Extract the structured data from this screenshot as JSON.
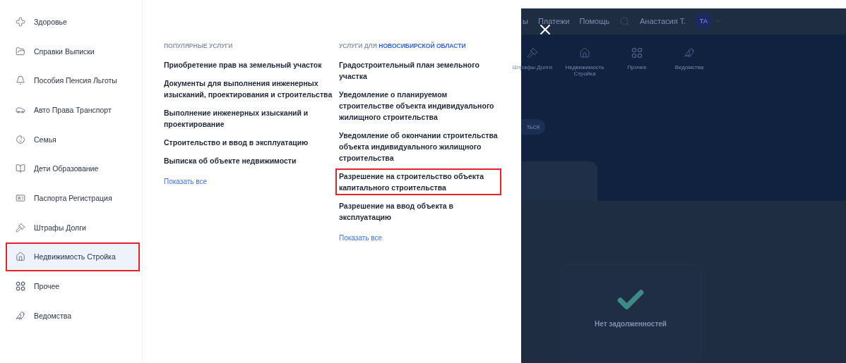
{
  "sidebar": {
    "items": [
      {
        "label": "Здоровье",
        "selected": false,
        "highlighted": false
      },
      {
        "label": "Справки Выписки",
        "selected": false,
        "highlighted": false
      },
      {
        "label": "Пособия Пенсия Льготы",
        "selected": false,
        "highlighted": false
      },
      {
        "label": "Авто Права Транспорт",
        "selected": false,
        "highlighted": false
      },
      {
        "label": "Семья",
        "selected": false,
        "highlighted": false
      },
      {
        "label": "Дети Образование",
        "selected": false,
        "highlighted": false
      },
      {
        "label": "Паспорта Регистрация",
        "selected": false,
        "highlighted": false
      },
      {
        "label": "Штрафы Долги",
        "selected": false,
        "highlighted": false
      },
      {
        "label": "Недвижимость Стройка",
        "selected": true,
        "highlighted": true
      },
      {
        "label": "Прочее",
        "selected": false,
        "highlighted": false
      },
      {
        "label": "Ведомства",
        "selected": false,
        "highlighted": false
      }
    ]
  },
  "popular": {
    "heading": "ПОПУЛЯРНЫЕ УСЛУГИ",
    "items": [
      {
        "label": "Приобретение прав на земельный участок",
        "highlighted": false
      },
      {
        "label": "Документы для выполнения инженерных изысканий, проектирования и строительства",
        "highlighted": false
      },
      {
        "label": "Выполнение инженерных изысканий и проектирование",
        "highlighted": false
      },
      {
        "label": "Строительство и ввод в эксплуатацию",
        "highlighted": false
      },
      {
        "label": "Выписка об объекте недвижимости",
        "highlighted": false
      }
    ],
    "show_all": "Показать все"
  },
  "regional": {
    "heading": "УСЛУГИ ДЛЯ",
    "heading_region": "НОВОСИБИРСКОЙ ОБЛАСТИ",
    "items": [
      {
        "label": "Градостроительный план земельного участка",
        "highlighted": false
      },
      {
        "label": "Уведомление о планируемом строительстве объекта индивидуального жилищного строительства",
        "highlighted": false
      },
      {
        "label": "Уведомление об окончании строительства объекта индивидуального жилищного строительства",
        "highlighted": false
      },
      {
        "label": "Разрешение на строительство объекта капитального строительства",
        "highlighted": true
      },
      {
        "label": "Разрешение на ввод объекта в эксплуатацию",
        "highlighted": false
      }
    ],
    "show_all": "Показать все"
  },
  "background_page": {
    "nav": [
      "ы",
      "Платежи",
      "Помощь"
    ],
    "user_name": "Анастасия Т.",
    "avatar": "ТА",
    "categories": [
      "Штрафы Долги",
      "Недвижимость Стройка",
      "Прочее",
      "Ведомства"
    ],
    "button": "ться",
    "status": "Нет задолженностей"
  }
}
